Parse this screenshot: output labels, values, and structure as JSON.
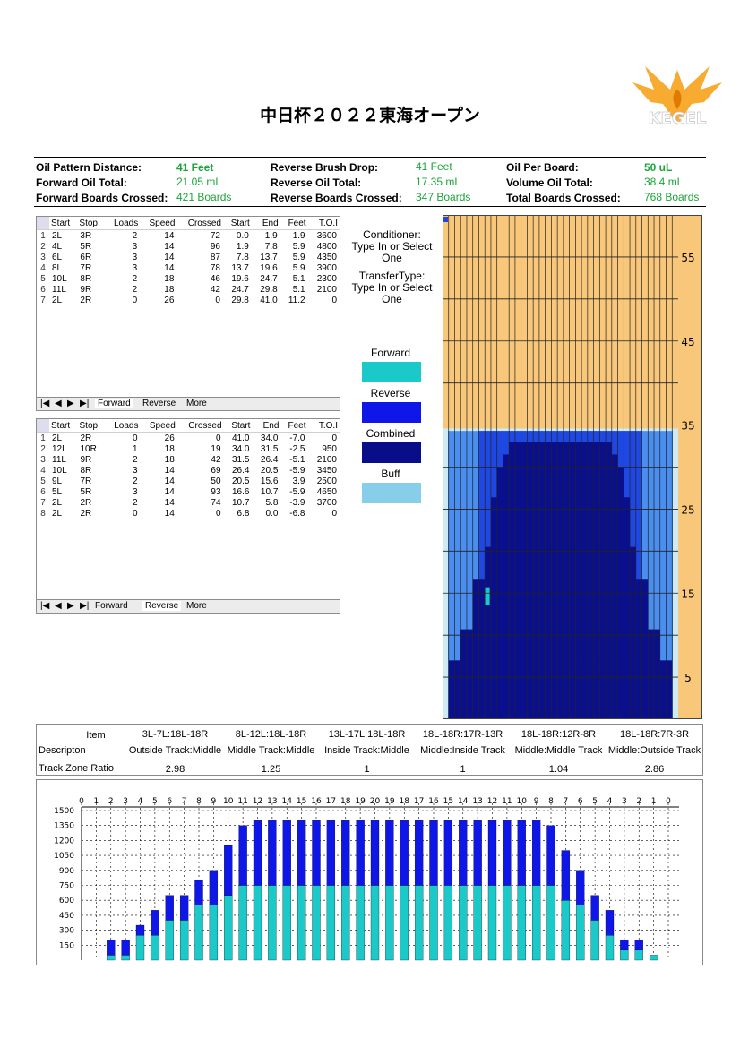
{
  "title": "中日杯２０２２東海オープン",
  "logo_text": "KEGEL",
  "summary": [
    {
      "label": "Oil Pattern Distance:",
      "value": "41 Feet",
      "bold": true
    },
    {
      "label": "Reverse Brush Drop:",
      "value": "41 Feet",
      "bold": false
    },
    {
      "label": "Oil Per Board:",
      "value": "50 uL",
      "bold": true
    },
    {
      "label": "Forward Oil Total:",
      "value": "21.05 mL",
      "bold": false
    },
    {
      "label": "Reverse Oil Total:",
      "value": "17.35 mL",
      "bold": false
    },
    {
      "label": "Volume Oil Total:",
      "value": "38.4 mL",
      "bold": false
    },
    {
      "label": "Forward Boards Crossed:",
      "value": "421 Boards",
      "bold": false
    },
    {
      "label": "Reverse Boards Crossed:",
      "value": "347 Boards",
      "bold": false
    },
    {
      "label": "Total Boards Crossed:",
      "value": "768 Boards",
      "bold": false
    }
  ],
  "forward_table": {
    "headers": [
      "Start",
      "Stop",
      "Loads",
      "Speed",
      "Crossed",
      "Start",
      "End",
      "Feet",
      "T.O.I"
    ],
    "rows": [
      [
        "1",
        "2L",
        "3R",
        "2",
        "14",
        "72",
        "0.0",
        "1.9",
        "1.9",
        "3600"
      ],
      [
        "2",
        "4L",
        "5R",
        "3",
        "14",
        "96",
        "1.9",
        "7.8",
        "5.9",
        "4800"
      ],
      [
        "3",
        "6L",
        "6R",
        "3",
        "14",
        "87",
        "7.8",
        "13.7",
        "5.9",
        "4350"
      ],
      [
        "4",
        "8L",
        "7R",
        "3",
        "14",
        "78",
        "13.7",
        "19.6",
        "5.9",
        "3900"
      ],
      [
        "5",
        "10L",
        "8R",
        "2",
        "18",
        "46",
        "19.6",
        "24.7",
        "5.1",
        "2300"
      ],
      [
        "6",
        "11L",
        "9R",
        "2",
        "18",
        "42",
        "24.7",
        "29.8",
        "5.1",
        "2100"
      ],
      [
        "7",
        "2L",
        "2R",
        "0",
        "26",
        "0",
        "29.8",
        "41.0",
        "11.2",
        "0"
      ]
    ],
    "tabs": [
      "Forward",
      "Reverse",
      "More"
    ]
  },
  "reverse_table": {
    "headers": [
      "Start",
      "Stop",
      "Loads",
      "Speed",
      "Crossed",
      "Start",
      "End",
      "Feet",
      "T.O.I"
    ],
    "rows": [
      [
        "1",
        "2L",
        "2R",
        "0",
        "26",
        "0",
        "41.0",
        "34.0",
        "-7.0",
        "0"
      ],
      [
        "2",
        "12L",
        "10R",
        "1",
        "18",
        "19",
        "34.0",
        "31.5",
        "-2.5",
        "950"
      ],
      [
        "3",
        "11L",
        "9R",
        "2",
        "18",
        "42",
        "31.5",
        "26.4",
        "-5.1",
        "2100"
      ],
      [
        "4",
        "10L",
        "8R",
        "3",
        "14",
        "69",
        "26.4",
        "20.5",
        "-5.9",
        "3450"
      ],
      [
        "5",
        "9L",
        "7R",
        "2",
        "14",
        "50",
        "20.5",
        "15.6",
        "3.9",
        "2500"
      ],
      [
        "6",
        "5L",
        "5R",
        "3",
        "14",
        "93",
        "16.6",
        "10.7",
        "-5.9",
        "4650"
      ],
      [
        "7",
        "2L",
        "2R",
        "2",
        "14",
        "74",
        "10.7",
        "5.8",
        "-3.9",
        "3700"
      ],
      [
        "8",
        "2L",
        "2R",
        "0",
        "14",
        "0",
        "6.8",
        "0.0",
        "-6.8",
        "0"
      ]
    ],
    "tabs": [
      "Forward",
      "Reverse",
      "More"
    ]
  },
  "conditioner": {
    "line1": "Conditioner:",
    "line2": "Type In or Select",
    "line3": "One",
    "line4": "TransferType:",
    "line5": "Type In or Select",
    "line6": "One"
  },
  "legend": [
    {
      "label": "Forward",
      "color": "#1cc9c9"
    },
    {
      "label": "Reverse",
      "color": "#0e16e8"
    },
    {
      "label": "Combined",
      "color": "#0a0d8a"
    },
    {
      "label": "Buff",
      "color": "#87ceeb"
    }
  ],
  "lane_graph": {
    "feet_labels": [
      "55",
      "45",
      "35",
      "25",
      "15",
      "5"
    ],
    "feet_values": [
      55,
      45,
      35,
      25,
      15,
      5
    ],
    "colors": {
      "dry": "#f9c77a",
      "buff": "#cdeaf5",
      "light": "#4a8ef0",
      "reverse": "#1f47e2",
      "combined": "#0a0f8e",
      "forward": "#1cc9c9"
    }
  },
  "zone_table": {
    "item_label": "Item",
    "desc_label": "Descripton",
    "ratio_label": "Track Zone Ratio",
    "columns": [
      {
        "item": "3L-7L:18L-18R",
        "desc": "Outside Track:Middle",
        "ratio": "2.98"
      },
      {
        "item": "8L-12L:18L-18R",
        "desc": "Mіddle Track:Middle",
        "ratio": "1.25"
      },
      {
        "item": "13L-17L:18L-18R",
        "desc": "Inside Track:Middle",
        "ratio": "1"
      },
      {
        "item": "18L-18R:17R-13R",
        "desc": "Middle:Inside Track",
        "ratio": "1"
      },
      {
        "item": "18L-18R:12R-8R",
        "desc": "Middle:Middle Track",
        "ratio": "1.04"
      },
      {
        "item": "18L-18R:7R-3R",
        "desc": "Middle:Outside Track",
        "ratio": "2.86"
      }
    ]
  },
  "chart_data": {
    "type": "bar",
    "stacked": true,
    "categories": [
      "0",
      "1",
      "2",
      "3",
      "4",
      "5",
      "6",
      "7",
      "8",
      "9",
      "10",
      "11",
      "12",
      "13",
      "14",
      "15",
      "16",
      "17",
      "18",
      "19",
      "20",
      "19",
      "18",
      "17",
      "16",
      "15",
      "14",
      "13",
      "12",
      "11",
      "10",
      "9",
      "8",
      "7",
      "6",
      "5",
      "4",
      "3",
      "2",
      "1",
      "0"
    ],
    "series": [
      {
        "color": "#1cc9c9",
        "values": [
          0,
          0,
          50,
          50,
          250,
          250,
          400,
          400,
          550,
          550,
          650,
          750,
          750,
          750,
          750,
          750,
          750,
          750,
          750,
          750,
          750,
          750,
          750,
          750,
          750,
          750,
          750,
          750,
          750,
          750,
          750,
          750,
          750,
          600,
          550,
          400,
          250,
          100,
          100,
          50,
          0
        ]
      },
      {
        "color": "#0e16e8",
        "values": [
          0,
          0,
          150,
          150,
          100,
          250,
          250,
          250,
          250,
          350,
          500,
          600,
          650,
          650,
          650,
          650,
          650,
          650,
          650,
          650,
          650,
          650,
          650,
          650,
          650,
          650,
          650,
          650,
          650,
          650,
          650,
          650,
          600,
          500,
          350,
          250,
          250,
          100,
          100,
          0,
          0
        ]
      }
    ],
    "yticks": [
      150,
      300,
      450,
      600,
      750,
      900,
      1050,
      1200,
      1350,
      1500
    ],
    "ylim": [
      0,
      1500
    ],
    "grid": true
  }
}
